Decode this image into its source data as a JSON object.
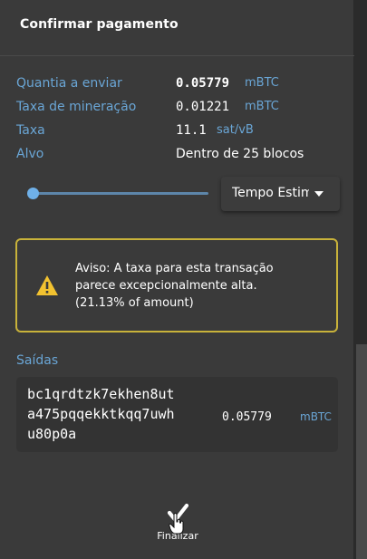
{
  "dialog": {
    "title": "Confirmar pagamento"
  },
  "details": {
    "amount_label": "Quantia a enviar",
    "amount_value": "0.05779",
    "amount_unit": "mBTC",
    "mining_fee_label": "Taxa de mineração",
    "mining_fee_value": "0.01221",
    "mining_fee_unit": "mBTC",
    "fee_rate_label": "Taxa",
    "fee_rate_value": "11.1",
    "fee_rate_unit": "sat/vB",
    "target_label": "Alvo",
    "target_value": "Dentro de 25 blocos"
  },
  "fee_slider": {
    "position": 0.0,
    "dropdown_value": "Tempo Estimado"
  },
  "warning": {
    "line1": "Aviso: A taxa para esta transação",
    "line2": "parece excepcionalmente alta.",
    "line3": "(21.13% of amount)"
  },
  "outputs": {
    "title": "Saídas",
    "items": [
      {
        "address_line1": "bc1qrdtzk7ekhen8ut",
        "address_line2": "a475pqqekktkqq7uwh",
        "address_line3": "u80p0a",
        "amount": "0.05779",
        "unit": "mBTC"
      }
    ]
  },
  "actions": {
    "finalize_label": "Finalizar"
  },
  "colors": {
    "accent": "#6aa6d6",
    "warning_border": "#c8b23a",
    "warning_icon": "#f2c230",
    "background": "#3a3a3a"
  },
  "icons": {
    "warning": "warning-triangle-icon",
    "finalize": "checkmark-icon",
    "dropdown": "caret-down-icon"
  }
}
